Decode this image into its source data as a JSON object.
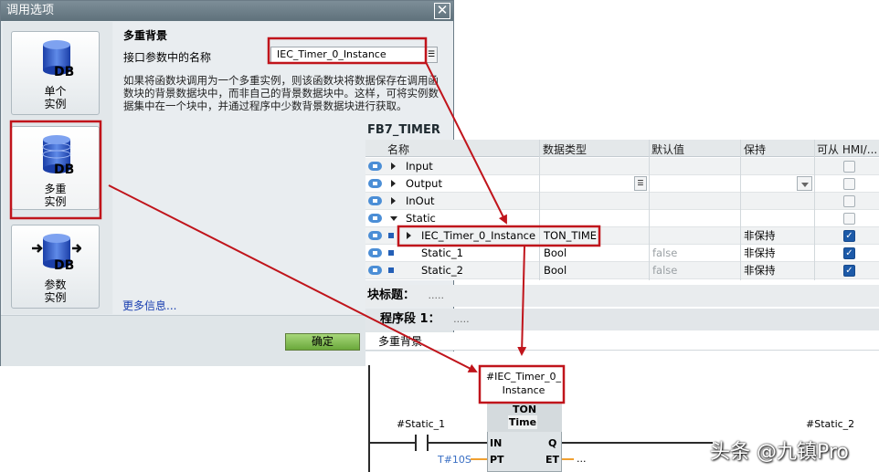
{
  "dialog": {
    "title": "调用选项",
    "close": "✕",
    "options": [
      {
        "line1": "单个",
        "line2": "实例",
        "db": "DB"
      },
      {
        "line1": "多重",
        "line2": "实例",
        "db": "DB"
      },
      {
        "line1": "参数",
        "line2": "实例",
        "db": "DB"
      }
    ],
    "section_title": "多重背景",
    "field_label": "接口参数中的名称",
    "field_value": "IEC_Timer_0_Instance",
    "description": "如果将函数块调用为一个多重实例，则该函数块将数据保存在调用函数块的背景数据块中，而非自己的背景数据块中。这样，可将实例数据集中在一个块中，并通过程序中少数背景数据块进行获取。",
    "more_info": "更多信息...",
    "ok": "确定"
  },
  "interface": {
    "block_name": "FB7_TIMER",
    "columns": [
      "名称",
      "数据类型",
      "默认值",
      "保持",
      "可从 HMI/..."
    ],
    "rows": [
      {
        "name": "Input",
        "type": "",
        "default": "",
        "retain": "",
        "hmi": false
      },
      {
        "name": "Output",
        "type": "",
        "default": "",
        "retain": "",
        "hmi": false
      },
      {
        "name": "InOut",
        "type": "",
        "default": "",
        "retain": "",
        "hmi": false
      },
      {
        "name": "Static",
        "type": "",
        "default": "",
        "retain": "",
        "hmi": false
      },
      {
        "name": "IEC_Timer_0_Instance",
        "type": "TON_TIME",
        "default": "",
        "retain": "非保持",
        "hmi": true
      },
      {
        "name": "Static_1",
        "type": "Bool",
        "default": "false",
        "retain": "非保持",
        "hmi": true
      },
      {
        "name": "Static_2",
        "type": "Bool",
        "default": "false",
        "retain": "非保持",
        "hmi": true
      }
    ]
  },
  "editor": {
    "block_title_label": "块标题：",
    "block_title_value": ".....",
    "network_label": "程序段 1：",
    "network_value": ".....",
    "network_comment": "多重背景",
    "instance_line1": "#IEC_Timer_0_",
    "instance_line2": "Instance",
    "fb_type": "TON",
    "fb_subtype": "Time",
    "pin_in": "IN",
    "pin_pt": "PT",
    "pin_q": "Q",
    "pin_et": "ET",
    "contact_in": "#Static_1",
    "coil_out": "#Static_2",
    "pt_value": "T#10S",
    "et_value": "..."
  },
  "watermark": "头条 @九镇Pro",
  "colors": {
    "highlight": "#c0141b",
    "ok_green": "#7cbd47",
    "accent_blue": "#245fb6",
    "pin_orange": "#f0a030"
  }
}
